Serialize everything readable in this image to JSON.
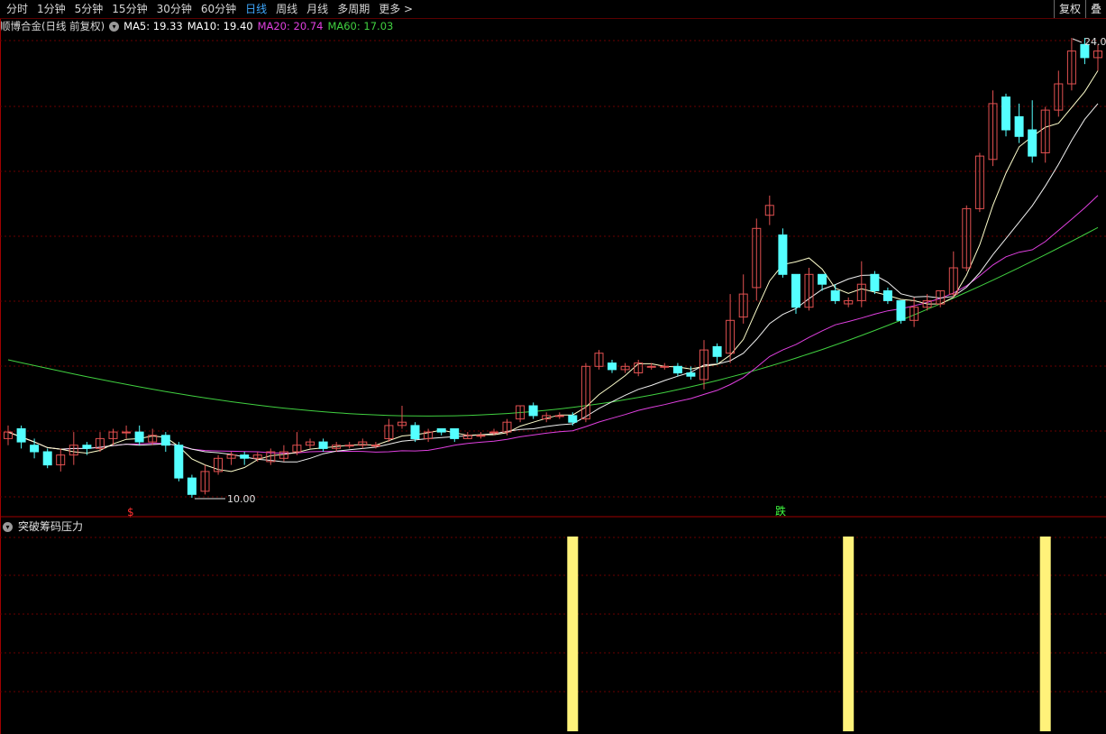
{
  "toolbar": {
    "tabs": [
      {
        "label": "分时",
        "active": false
      },
      {
        "label": "1分钟",
        "active": false
      },
      {
        "label": "5分钟",
        "active": false
      },
      {
        "label": "15分钟",
        "active": false
      },
      {
        "label": "30分钟",
        "active": false
      },
      {
        "label": "60分钟",
        "active": false
      },
      {
        "label": "日线",
        "active": true
      },
      {
        "label": "周线",
        "active": false
      },
      {
        "label": "月线",
        "active": false
      },
      {
        "label": "多周期",
        "active": false
      },
      {
        "label": "更多 >",
        "active": false
      }
    ],
    "restore_label": "复权",
    "extra_label": "叠"
  },
  "info": {
    "stock_title": "顺博合金(日线 前复权)",
    "ma5": "MA5: 19.33",
    "ma10": "MA10: 19.40",
    "ma20": "MA20: 20.74",
    "ma60": "MA60: 17.03",
    "ma5_color": "#ffffff",
    "ma10_color": "#ffffff",
    "ma20_color": "#e040e0",
    "ma60_color": "#40d040"
  },
  "markers": {
    "low_label": "10.00",
    "high_label": "24.0",
    "signal_s": "$",
    "signal_die": "跌"
  },
  "indicator": {
    "label": "突破筹码压力",
    "bar_color": "#fff27a"
  },
  "chart_data": [
    {
      "type": "candlestick",
      "series": [
        {
          "name": "MA5"
        },
        {
          "name": "MA10"
        },
        {
          "name": "MA20"
        },
        {
          "name": "MA60"
        }
      ],
      "min_price": 10.0,
      "max_price": 24.0,
      "colors": {
        "up": "#e05050",
        "down": "#54ffff"
      },
      "candles": [
        [
          11.8,
          12.0,
          11.6,
          12.2
        ],
        [
          12.1,
          11.7,
          11.5,
          12.2
        ],
        [
          11.6,
          11.4,
          11.2,
          11.8
        ],
        [
          11.4,
          11.0,
          10.9,
          11.5
        ],
        [
          11.0,
          11.3,
          10.8,
          11.5
        ],
        [
          11.3,
          11.6,
          11.0,
          12.0
        ],
        [
          11.6,
          11.5,
          11.3,
          11.7
        ],
        [
          11.5,
          11.8,
          11.4,
          12.0
        ],
        [
          11.8,
          12.0,
          11.6,
          12.1
        ],
        [
          12.0,
          12.0,
          11.8,
          12.2
        ],
        [
          12.0,
          11.7,
          11.6,
          12.2
        ],
        [
          11.7,
          11.9,
          11.6,
          12.1
        ],
        [
          11.9,
          11.6,
          11.4,
          12.0
        ],
        [
          11.6,
          10.6,
          10.5,
          11.7
        ],
        [
          10.6,
          10.1,
          10.0,
          10.7
        ],
        [
          10.2,
          10.8,
          10.1,
          11.0
        ],
        [
          10.8,
          11.2,
          10.7,
          11.3
        ],
        [
          11.2,
          11.3,
          11.0,
          11.4
        ],
        [
          11.3,
          11.2,
          11.0,
          11.4
        ],
        [
          11.2,
          11.3,
          11.1,
          11.4
        ],
        [
          11.1,
          11.4,
          11.0,
          11.5
        ],
        [
          11.2,
          11.4,
          11.1,
          11.6
        ],
        [
          11.4,
          11.6,
          11.3,
          12.0
        ],
        [
          11.6,
          11.7,
          11.5,
          11.8
        ],
        [
          11.7,
          11.5,
          11.4,
          11.8
        ],
        [
          11.5,
          11.6,
          11.4,
          11.7
        ],
        [
          11.6,
          11.6,
          11.5,
          11.7
        ],
        [
          11.6,
          11.7,
          11.5,
          11.8
        ],
        [
          11.6,
          11.6,
          11.5,
          11.7
        ],
        [
          11.8,
          12.2,
          11.7,
          12.4
        ],
        [
          12.2,
          12.3,
          12.1,
          12.8
        ],
        [
          12.2,
          11.8,
          11.7,
          12.3
        ],
        [
          11.8,
          12.0,
          11.7,
          12.1
        ],
        [
          12.1,
          12.0,
          11.9,
          12.1
        ],
        [
          12.1,
          11.8,
          11.7,
          12.1
        ],
        [
          11.8,
          11.9,
          11.8,
          12.0
        ],
        [
          11.9,
          11.9,
          11.8,
          12.0
        ],
        [
          12.0,
          12.0,
          11.9,
          12.1
        ],
        [
          12.0,
          12.3,
          11.9,
          12.4
        ],
        [
          12.4,
          12.8,
          12.3,
          12.8
        ],
        [
          12.8,
          12.5,
          12.4,
          12.9
        ],
        [
          12.4,
          12.5,
          12.3,
          12.6
        ],
        [
          12.5,
          12.5,
          12.4,
          12.6
        ],
        [
          12.5,
          12.3,
          12.2,
          12.6
        ],
        [
          12.4,
          14.0,
          12.3,
          14.1
        ],
        [
          14.0,
          14.4,
          13.9,
          14.5
        ],
        [
          14.1,
          13.9,
          13.8,
          14.2
        ],
        [
          13.9,
          14.0,
          13.8,
          14.1
        ],
        [
          13.8,
          14.1,
          13.7,
          14.2
        ],
        [
          14.0,
          14.0,
          13.9,
          14.1
        ],
        [
          14.0,
          14.0,
          13.9,
          14.1
        ],
        [
          14.0,
          13.8,
          13.7,
          14.1
        ],
        [
          13.8,
          13.7,
          13.6,
          14.0
        ],
        [
          13.6,
          14.5,
          13.3,
          14.8
        ],
        [
          14.6,
          14.3,
          14.1,
          14.7
        ],
        [
          14.4,
          15.4,
          14.1,
          16.2
        ],
        [
          15.5,
          16.2,
          15.3,
          16.8
        ],
        [
          16.4,
          18.2,
          16.0,
          18.5
        ],
        [
          18.6,
          18.9,
          18.3,
          19.2
        ],
        [
          18.0,
          16.8,
          16.7,
          18.2
        ],
        [
          16.8,
          15.8,
          15.6,
          16.8
        ],
        [
          15.8,
          16.8,
          15.7,
          17.0
        ],
        [
          16.8,
          16.5,
          16.3,
          16.8
        ],
        [
          16.3,
          16.0,
          15.9,
          16.5
        ],
        [
          15.9,
          16.0,
          15.8,
          16.1
        ],
        [
          16.0,
          16.5,
          15.8,
          17.2
        ],
        [
          16.8,
          16.3,
          16.2,
          16.9
        ],
        [
          16.3,
          16.0,
          15.9,
          16.4
        ],
        [
          16.0,
          15.4,
          15.3,
          16.0
        ],
        [
          15.4,
          15.8,
          15.2,
          16.1
        ],
        [
          15.8,
          16.0,
          15.7,
          16.2
        ],
        [
          15.9,
          16.3,
          15.8,
          16.3
        ],
        [
          16.2,
          17.0,
          16.1,
          17.5
        ],
        [
          17.0,
          18.8,
          16.9,
          18.9
        ],
        [
          18.8,
          20.4,
          18.7,
          20.5
        ],
        [
          20.3,
          22.0,
          20.1,
          22.4
        ],
        [
          22.2,
          21.2,
          21.0,
          22.3
        ],
        [
          21.6,
          21.0,
          20.8,
          22.0
        ],
        [
          21.2,
          20.4,
          20.2,
          22.1
        ],
        [
          20.5,
          21.8,
          20.2,
          21.9
        ],
        [
          21.8,
          22.6,
          21.6,
          23.0
        ],
        [
          22.6,
          23.6,
          22.4,
          24.0
        ],
        [
          23.8,
          23.4,
          23.2,
          24.0
        ],
        [
          23.4,
          23.6,
          23.0,
          23.8
        ]
      ],
      "ma60_start": 14.2,
      "ma60_end": 17.03
    },
    {
      "type": "bar",
      "name": "突破筹码压力",
      "signal_candle_indexes": [
        43,
        64,
        79
      ],
      "values": [
        1,
        1,
        1
      ]
    }
  ]
}
